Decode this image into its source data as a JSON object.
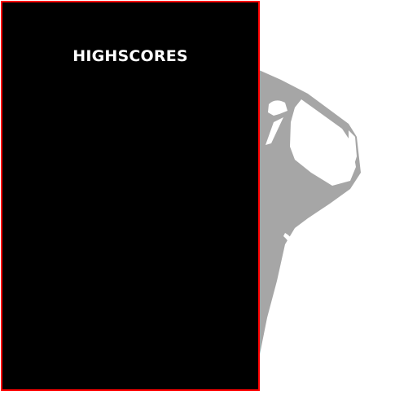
{
  "highscores": {
    "title": "HIGHSCORES",
    "entries": []
  },
  "colors": {
    "panel_background": "#000000",
    "panel_border": "#ff0000",
    "title_text": "#ffffff",
    "artwork_fill": "#a6a6a6",
    "page_background": "#ffffff"
  },
  "icons": {
    "background_art": "grey-bird-silhouette-icon"
  }
}
